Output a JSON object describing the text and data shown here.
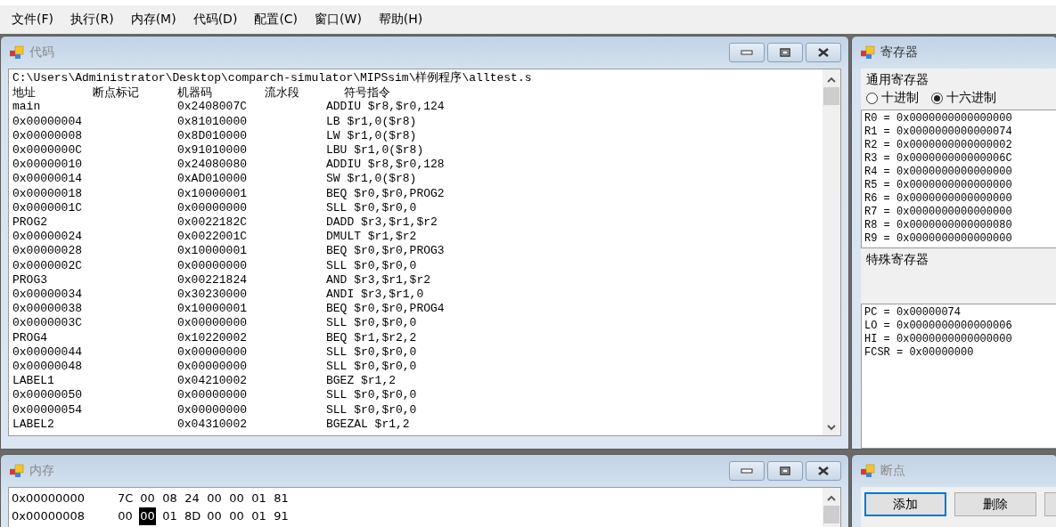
{
  "menu": [
    "文件(F)",
    "执行(R)",
    "内存(M)",
    "代码(D)",
    "配置(C)",
    "窗口(W)",
    "帮助(H)"
  ],
  "code_window": {
    "title": "代码",
    "path": "C:\\Users\\Administrator\\Desktop\\comparch-simulator\\MIPSsim\\样例程序\\alltest.s",
    "columns": [
      "地址",
      "断点标记",
      "机器码",
      "流水段",
      "符号指令"
    ],
    "rows": [
      {
        "address": "main",
        "machine_code": "0x2408007C",
        "instruction": "ADDIU $r8,$r0,124"
      },
      {
        "address": "0x00000004",
        "machine_code": "0x81010000",
        "instruction": "LB $r1,0($r8)"
      },
      {
        "address": "0x00000008",
        "machine_code": "0x8D010000",
        "instruction": "LW $r1,0($r8)"
      },
      {
        "address": "0x0000000C",
        "machine_code": "0x91010000",
        "instruction": "LBU $r1,0($r8)"
      },
      {
        "address": "0x00000010",
        "machine_code": "0x24080080",
        "instruction": "ADDIU $r8,$r0,128"
      },
      {
        "address": "0x00000014",
        "machine_code": "0xAD010000",
        "instruction": "SW $r1,0($r8)"
      },
      {
        "address": "0x00000018",
        "machine_code": "0x10000001",
        "instruction": "BEQ $r0,$r0,PROG2"
      },
      {
        "address": "0x0000001C",
        "machine_code": "0x00000000",
        "instruction": "SLL $r0,$r0,0"
      },
      {
        "address": "PROG2",
        "machine_code": "0x0022182C",
        "instruction": "DADD $r3,$r1,$r2"
      },
      {
        "address": "0x00000024",
        "machine_code": "0x0022001C",
        "instruction": "DMULT $r1,$r2"
      },
      {
        "address": "0x00000028",
        "machine_code": "0x10000001",
        "instruction": "BEQ $r0,$r0,PROG3"
      },
      {
        "address": "0x0000002C",
        "machine_code": "0x00000000",
        "instruction": "SLL $r0,$r0,0"
      },
      {
        "address": "PROG3",
        "machine_code": "0x00221824",
        "instruction": "AND $r3,$r1,$r2"
      },
      {
        "address": "0x00000034",
        "machine_code": "0x30230000",
        "instruction": "ANDI $r3,$r1,0"
      },
      {
        "address": "0x00000038",
        "machine_code": "0x10000001",
        "instruction": "BEQ $r0,$r0,PROG4"
      },
      {
        "address": "0x0000003C",
        "machine_code": "0x00000000",
        "instruction": "SLL $r0,$r0,0"
      },
      {
        "address": "PROG4",
        "machine_code": "0x10220002",
        "instruction": "BEQ $r1,$r2,2"
      },
      {
        "address": "0x00000044",
        "machine_code": "0x00000000",
        "instruction": "SLL $r0,$r0,0"
      },
      {
        "address": "0x00000048",
        "machine_code": "0x00000000",
        "instruction": "SLL $r0,$r0,0"
      },
      {
        "address": "LABEL1",
        "machine_code": "0x04210002",
        "instruction": "BGEZ $r1,2"
      },
      {
        "address": "0x00000050",
        "machine_code": "0x00000000",
        "instruction": "SLL $r0,$r0,0"
      },
      {
        "address": "0x00000054",
        "machine_code": "0x00000000",
        "instruction": "SLL $r0,$r0,0"
      },
      {
        "address": "LABEL2",
        "machine_code": "0x04310002",
        "instruction": "BGEZAL $r1,2"
      }
    ]
  },
  "register_window": {
    "title": "寄存器",
    "general_label": "通用寄存器",
    "radix_options": [
      {
        "label": "十进制",
        "selected": false
      },
      {
        "label": "十六进制",
        "selected": true
      }
    ],
    "general_registers": [
      "R0 = 0x0000000000000000",
      "R1 = 0x0000000000000074",
      "R2 = 0x0000000000000002",
      "R3 = 0x000000000000006C",
      "R4 = 0x0000000000000000",
      "R5 = 0x0000000000000000",
      "R6 = 0x0000000000000000",
      "R7 = 0x0000000000000000",
      "R8 = 0x0000000000000080",
      "R9 = 0x0000000000000000"
    ],
    "special_label": "特殊寄存器",
    "special_registers": [
      "PC = 0x00000074",
      "LO = 0x0000000000000006",
      "HI = 0x0000000000000000",
      "FCSR = 0x00000000"
    ]
  },
  "memory_window": {
    "title": "内存",
    "rows": [
      {
        "address": "0x00000000",
        "bytes": [
          {
            "value": "7C",
            "selected": false
          },
          {
            "value": "00",
            "selected": false
          },
          {
            "value": "08",
            "selected": false
          },
          {
            "value": "24",
            "selected": false
          },
          {
            "value": "00",
            "selected": false
          },
          {
            "value": "00",
            "selected": false
          },
          {
            "value": "01",
            "selected": false
          },
          {
            "value": "81",
            "selected": false
          }
        ]
      },
      {
        "address": "0x00000008",
        "bytes": [
          {
            "value": "00",
            "selected": false
          },
          {
            "value": "00",
            "selected": true
          },
          {
            "value": "01",
            "selected": false
          },
          {
            "value": "8D",
            "selected": false
          },
          {
            "value": "00",
            "selected": false
          },
          {
            "value": "00",
            "selected": false
          },
          {
            "value": "01",
            "selected": false
          },
          {
            "value": "91",
            "selected": false
          }
        ]
      }
    ]
  },
  "breakpoint_window": {
    "title": "断点",
    "buttons": [
      "添加",
      "删除"
    ]
  }
}
